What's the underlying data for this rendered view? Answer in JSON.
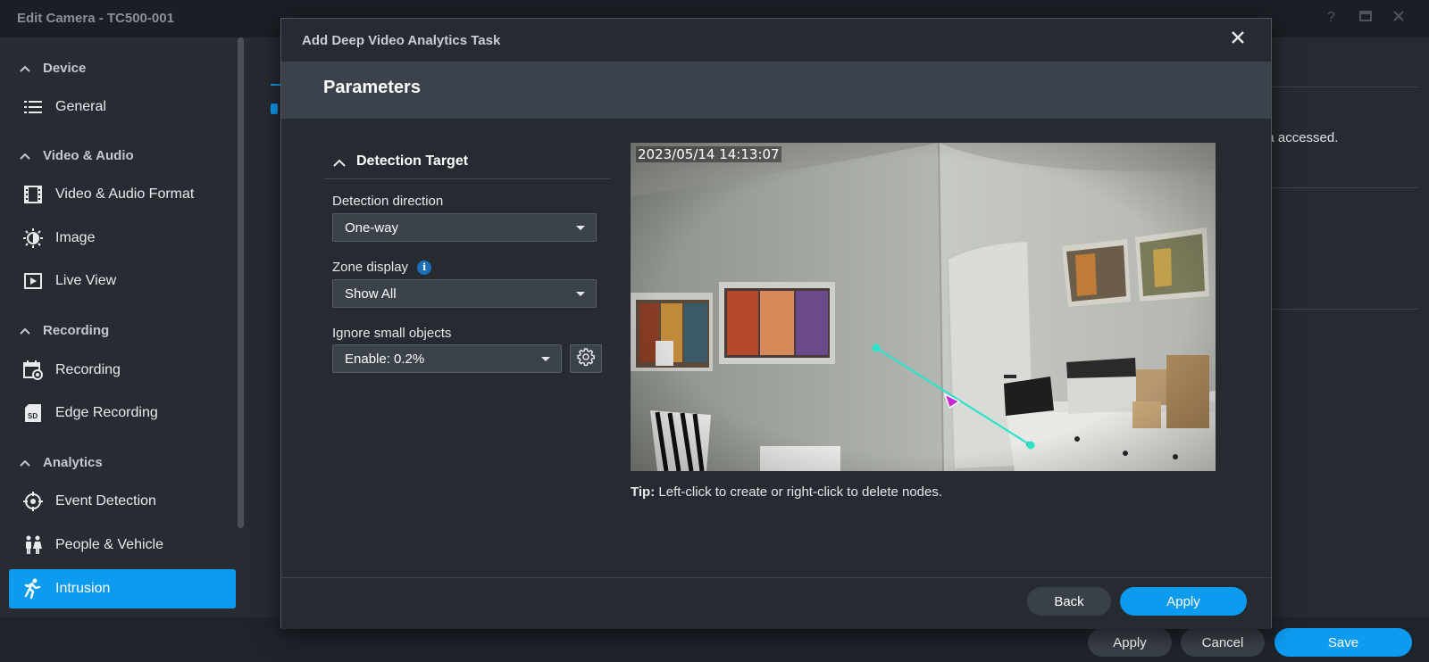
{
  "window": {
    "title": "Edit Camera - TC500-001",
    "controls": [
      "help-icon",
      "maximize-icon",
      "close-icon"
    ]
  },
  "sidebar": {
    "groups": [
      {
        "label": "Device",
        "items": [
          {
            "label": "General",
            "icon": "list-icon"
          }
        ]
      },
      {
        "label": "Video & Audio",
        "items": [
          {
            "label": "Video & Audio Format",
            "icon": "film-icon"
          },
          {
            "label": "Image",
            "icon": "brightness-icon"
          },
          {
            "label": "Live View",
            "icon": "play-icon"
          }
        ]
      },
      {
        "label": "Recording",
        "items": [
          {
            "label": "Recording",
            "icon": "calendar-record-icon"
          },
          {
            "label": "Edge Recording",
            "icon": "sd-card-icon"
          }
        ]
      },
      {
        "label": "Analytics",
        "items": [
          {
            "label": "Event Detection",
            "icon": "crosshair-icon"
          },
          {
            "label": "People & Vehicle",
            "icon": "people-icon"
          },
          {
            "label": "Intrusion",
            "icon": "running-person-icon",
            "active": true
          }
        ]
      }
    ]
  },
  "main": {
    "partial_text": "ea accessed."
  },
  "footer": {
    "apply": "Apply",
    "cancel": "Cancel",
    "save": "Save"
  },
  "modal": {
    "title": "Add Deep Video Analytics Task",
    "section_band": "Parameters",
    "detection_target": {
      "title": "Detection Target",
      "direction_label": "Detection direction",
      "direction_value": "One-way",
      "zone_label": "Zone display",
      "zone_value": "Show All",
      "ignore_label": "Ignore small objects",
      "ignore_value": "Enable: 0.2%"
    },
    "preview": {
      "timestamp": "2023/05/14 14:13:07"
    },
    "tip": {
      "prefix": "Tip:",
      "text": " Left-click to create or right-click to delete nodes."
    },
    "back": "Back",
    "apply": "Apply"
  },
  "colors": {
    "accent": "#0d9bf0",
    "line": "#2fe3c9",
    "direction_arrow": "#c928d6"
  }
}
